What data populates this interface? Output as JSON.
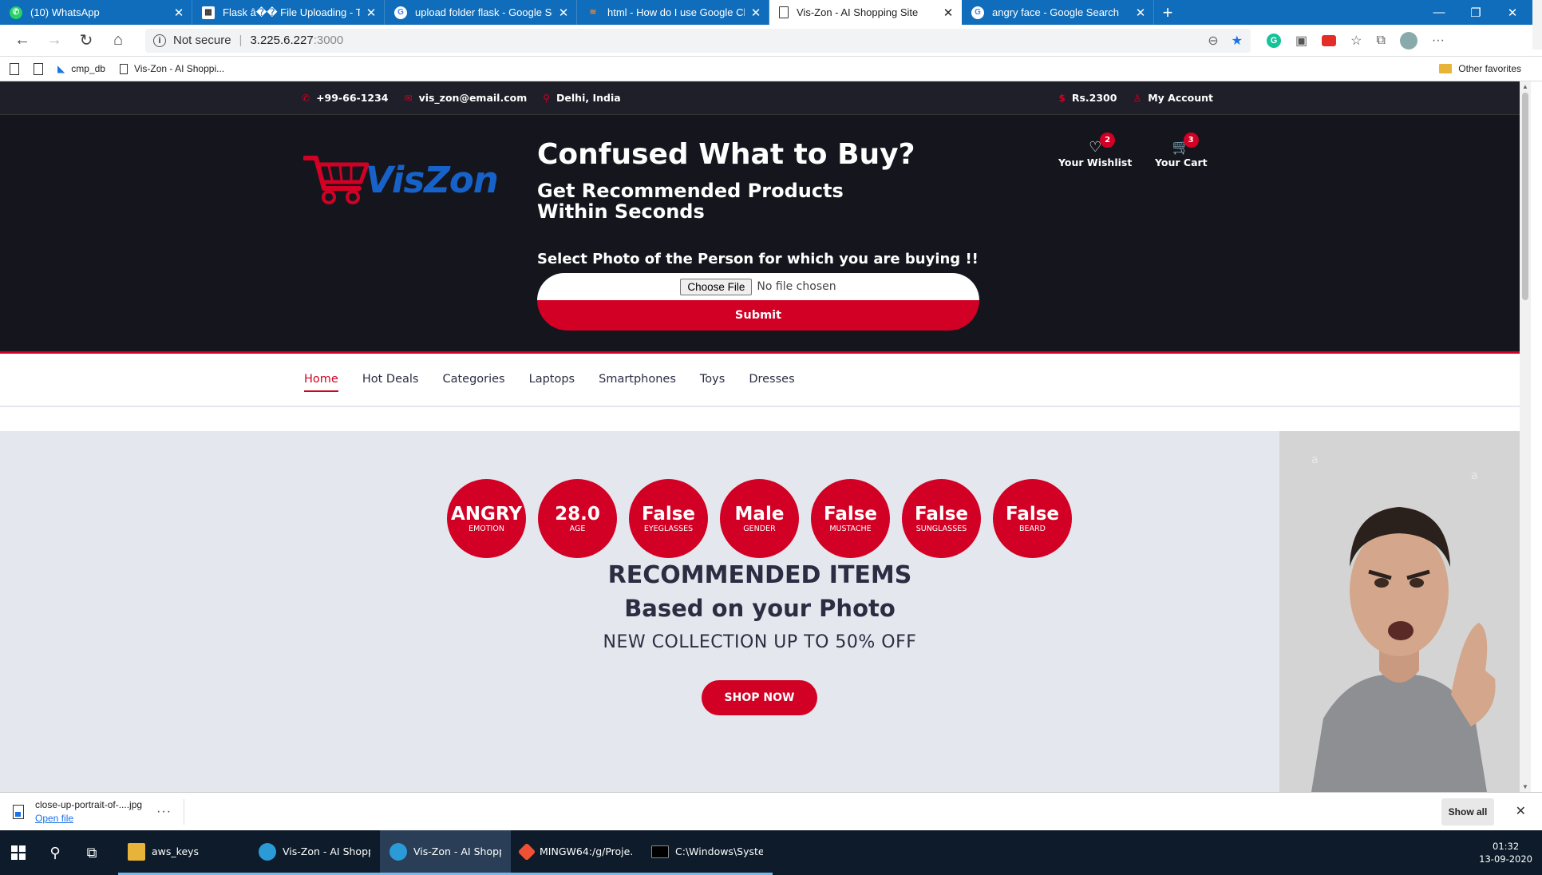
{
  "browser": {
    "tabs": [
      {
        "title": "(10) WhatsApp",
        "icon": "whatsapp-icon",
        "icon_color": "#25d366"
      },
      {
        "title": "Flask â�� File Uploading - Tuto",
        "icon": "page-favicon-icon",
        "icon_color": "#ffffff"
      },
      {
        "title": "upload folder flask - Google Sea",
        "icon": "google-icon",
        "icon_color": "#ffffff"
      },
      {
        "title": "html - How do I use Google Chr",
        "icon": "stackoverflow-icon",
        "icon_color": "#f48024"
      },
      {
        "title": "Vis-Zon - AI Shopping Site",
        "icon": "page-icon",
        "icon_color": "#ffffff"
      },
      {
        "title": "angry face - Google Search",
        "icon": "google-icon",
        "icon_color": "#ffffff"
      }
    ],
    "active_tab": 4,
    "address": {
      "security": "Not secure",
      "host": "3.225.6.227",
      "port": ":3000"
    },
    "favorites": [
      {
        "label": "cmp_db",
        "icon": "bookmark-icon"
      },
      {
        "label": "Vis-Zon - AI Shoppi...",
        "icon": "page-icon"
      }
    ],
    "other_favorites": "Other favorites"
  },
  "site": {
    "top_header": {
      "phone": "+99-66-1234",
      "email": "vis_zon@email.com",
      "location": "Delhi, India",
      "currency": "Rs.2300",
      "account": "My Account"
    },
    "logo_text": "VisZon",
    "headline": "Confused What to Buy?",
    "subheadline": "Get Recommended Products Within Seconds",
    "select_label": "Select Photo of the Person for which you are buying !!",
    "file_input": {
      "button": "Choose File",
      "status": "No file chosen"
    },
    "submit": "Submit",
    "wishlist": {
      "label": "Your Wishlist",
      "count": "2"
    },
    "cart": {
      "label": "Your Cart",
      "count": "3"
    },
    "nav": [
      "Home",
      "Hot Deals",
      "Categories",
      "Laptops",
      "Smartphones",
      "Toys",
      "Dresses"
    ],
    "active_nav": 0,
    "attributes": [
      {
        "value": "ANGRY",
        "label": "EMOTION"
      },
      {
        "value": "28.0",
        "label": "AGE"
      },
      {
        "value": "False",
        "label": "EYEGLASSES"
      },
      {
        "value": "Male",
        "label": "GENDER"
      },
      {
        "value": "False",
        "label": "MUSTACHE"
      },
      {
        "value": "False",
        "label": "SUNGLASSES"
      },
      {
        "value": "False",
        "label": "BEARD"
      }
    ],
    "recommended_title": "RECOMMENDED ITEMS",
    "recommended_subtitle": "Based on your Photo",
    "collection_text": "NEW COLLECTION UP TO 50% OFF",
    "shop_now": "SHOP NOW",
    "accent_color": "#d10024"
  },
  "downloads": {
    "file": "close-up-portrait-of-....jpg",
    "action": "Open file",
    "show_all": "Show all"
  },
  "taskbar": {
    "apps": [
      {
        "label": "aws_keys",
        "icon": "folder-icon"
      },
      {
        "label": "Vis-Zon - AI Shoppi...",
        "icon": "edge-icon"
      },
      {
        "label": "Vis-Zon - AI Shoppi...",
        "icon": "edge-icon"
      },
      {
        "label": "MINGW64:/g/Proje...",
        "icon": "git-bash-icon"
      },
      {
        "label": "C:\\Windows\\Syste...",
        "icon": "cmd-icon"
      }
    ],
    "time": "01:32",
    "date": "13-09-2020"
  }
}
